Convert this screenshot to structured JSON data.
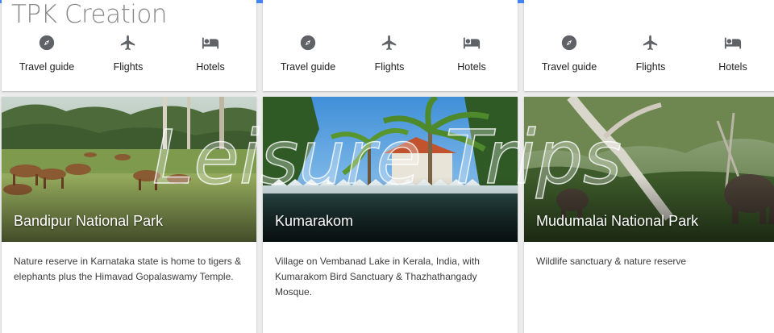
{
  "brand": "TPK Creation",
  "watermark": "Leisure Trips",
  "cards": [
    {
      "title": "Bandipur National Park",
      "description": "Nature reserve in Karnataka state is home to tigers & elephants plus the Himavad Gopalaswamy Temple.",
      "actions": [
        "Travel guide",
        "Flights",
        "Hotels"
      ]
    },
    {
      "title": "Kumarakom",
      "description": "Village on Vembanad Lake in Kerala, India, with Kumarakom Bird Sanctuary & Thazhathangady Mosque.",
      "actions": [
        "Travel guide",
        "Flights",
        "Hotels"
      ]
    },
    {
      "title": "Mudumalai National Park",
      "description": "Wildlife sanctuary & nature reserve",
      "actions": [
        "Travel guide",
        "Flights",
        "Hotels"
      ]
    }
  ],
  "icons": {
    "travel_guide": "compass-icon",
    "flights": "airplane-icon",
    "hotels": "bed-icon"
  },
  "colors": {
    "accent": "#4285f4",
    "icon": "#5f6368",
    "text": "#212121",
    "background": "#ececec"
  }
}
